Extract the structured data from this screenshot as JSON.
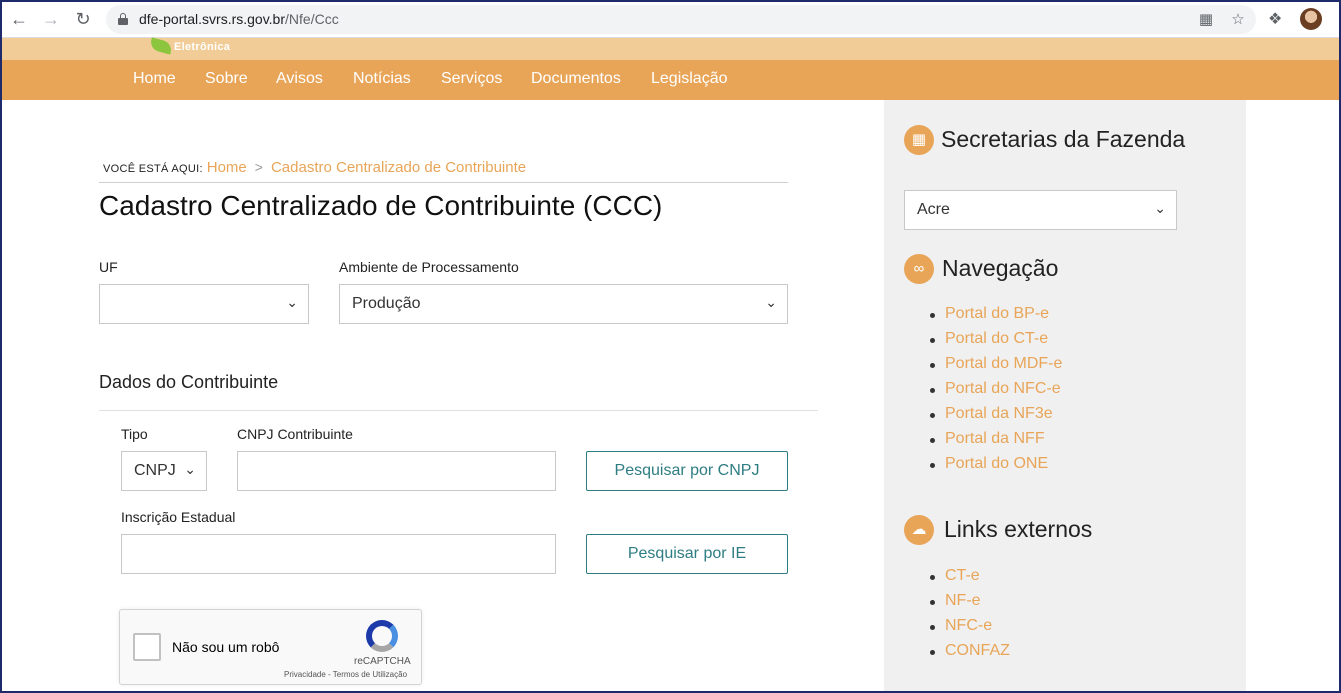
{
  "browser": {
    "url_host": "dfe-portal.svrs.rs.gov.br",
    "url_path": "/Nfe/Ccc"
  },
  "site": {
    "logo_text": "Eletrônica",
    "nav": [
      "Home",
      "Sobre",
      "Avisos",
      "Notícias",
      "Serviços",
      "Documentos",
      "Legislação"
    ]
  },
  "breadcrumb": {
    "label": "Você está aqui:",
    "home": "Home",
    "separator": ">",
    "current": "Cadastro Centralizado de Contribuinte"
  },
  "page_title": "Cadastro Centralizado de Contribuinte (CCC)",
  "form": {
    "uf_label": "UF",
    "uf_value": "",
    "ambiente_label": "Ambiente de Processamento",
    "ambiente_value": "Produção",
    "section_title": "Dados do Contribuinte",
    "tipo_label": "Tipo",
    "tipo_value": "CNPJ",
    "cnpj_label": "CNPJ Contribuinte",
    "cnpj_value": "",
    "search_cnpj_button": "Pesquisar por CNPJ",
    "ie_label": "Inscrição Estadual",
    "ie_value": "",
    "search_ie_button": "Pesquisar por IE"
  },
  "recaptcha": {
    "label": "Não sou um robô",
    "brand": "reCAPTCHA",
    "terms": "Privacidade - Termos de Utilização"
  },
  "sidebar": {
    "secretarias_title": "Secretarias da Fazenda",
    "secretarias_value": "Acre",
    "navegacao_title": "Navegação",
    "navegacao_items": [
      "Portal do BP-e",
      "Portal do CT-e",
      "Portal do MDF-e",
      "Portal do NFC-e",
      "Portal da NF3e",
      "Portal da NFF",
      "Portal do ONE"
    ],
    "links_title": "Links externos",
    "links_items": [
      "CT-e",
      "NF-e",
      "NFC-e",
      "CONFAZ"
    ]
  },
  "colors": {
    "accent_orange": "#e8a558",
    "header_light": "#f2cc97",
    "button_teal": "#2e7d82",
    "sidebar_bg": "#f0f0f0"
  },
  "icons": {
    "back": "arrow-left-icon",
    "forward": "arrow-right-icon",
    "reload": "reload-icon",
    "lock": "lock-icon",
    "qr": "qr-code-icon",
    "star": "star-icon",
    "extensions": "puzzle-icon",
    "secretarias": "building-icon",
    "navegacao": "link-icon",
    "links": "cloud-icon"
  }
}
